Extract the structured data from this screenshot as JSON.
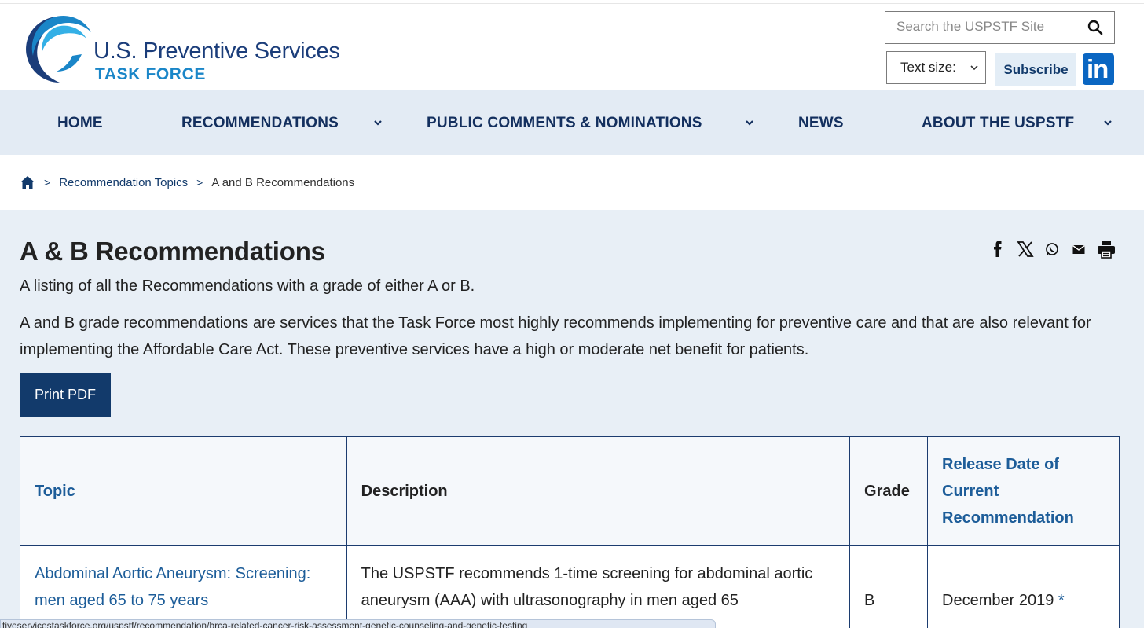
{
  "header": {
    "logo_line1": "U.S. Preventive Services",
    "logo_line2": "TASK FORCE",
    "search_placeholder": "Search the USPSTF Site",
    "text_size_label": "Text size:",
    "subscribe_label": "Subscribe",
    "linkedin_label": "in"
  },
  "nav": {
    "items": [
      {
        "label": "HOME"
      },
      {
        "label": "RECOMMENDATIONS"
      },
      {
        "label": "PUBLIC COMMENTS & NOMINATIONS"
      },
      {
        "label": "NEWS"
      },
      {
        "label": "ABOUT THE USPSTF"
      }
    ]
  },
  "breadcrumb": {
    "separator": ">",
    "topics": "Recommendation Topics",
    "current": "A and B Recommendations"
  },
  "page": {
    "title": "A & B Recommendations",
    "intro1": "A listing of all the Recommendations with a grade of either A or B.",
    "intro2": "A and B grade recommendations are services that the Task Force most highly recommends implementing for preventive care and that are also relevant for implementing the Affordable Care Act. These preventive services have a high or moderate net benefit for patients.",
    "print_pdf": "Print PDF"
  },
  "share_icons": [
    "facebook-icon",
    "x-icon",
    "whatsapp-icon",
    "email-icon",
    "print-icon"
  ],
  "table": {
    "headers": {
      "topic": "Topic",
      "description": "Description",
      "grade": "Grade",
      "release_date": "Release Date of Current Recommendation"
    },
    "rows": [
      {
        "topic": "Abdominal Aortic Aneurysm: Screening: men aged 65 to 75 years",
        "description": "The USPSTF recommends 1-time screening for abdominal aortic aneurysm (AAA) with ultrasonography in men aged 65",
        "grade": "B",
        "date": "December 2019",
        "asterisk": "*"
      }
    ]
  },
  "status_bar": {
    "url": "tiveservicestaskforce.org/uspstf/recommendation/brca-related-cancer-risk-assessment-genetic-counseling-and-genetic-testing"
  },
  "colors": {
    "navy": "#123a6b",
    "link_blue": "#1d5d99",
    "nav_bg": "#e3ebf4",
    "main_bg": "#e8eff6",
    "linkedin": "#0a66c2"
  }
}
